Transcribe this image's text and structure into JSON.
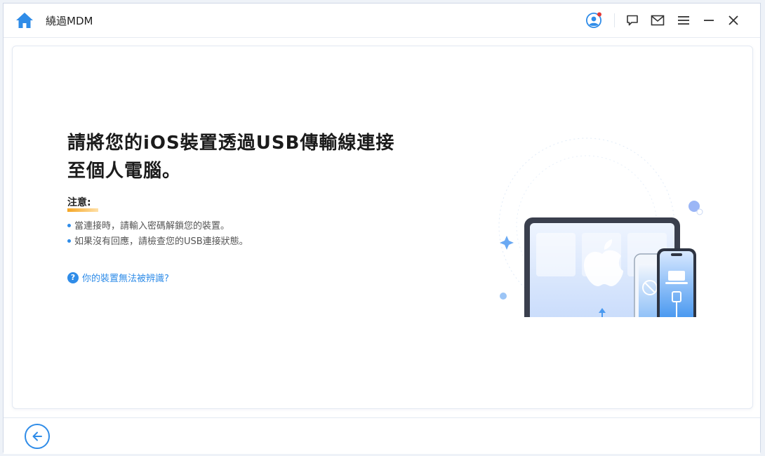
{
  "titlebar": {
    "app_title": "繞過MDM",
    "icons": [
      "home-icon",
      "user-avatar-icon",
      "feedback-icon",
      "mail-icon",
      "menu-icon",
      "minimize-icon",
      "close-icon"
    ]
  },
  "main": {
    "heading": "請將您的iOS裝置透過USB傳輸線連接至個人電腦。",
    "note_title": "注意:",
    "notes": [
      "當連接時，請輸入密碼解鎖您的裝置。",
      "如果沒有回應，請檢查您的USB連接狀態。"
    ],
    "help_link": "你的裝置無法被辨識?"
  },
  "footer": {
    "icons": [
      "back-arrow-icon"
    ]
  },
  "colors": {
    "accent": "#2f8ce8",
    "note_underline": "#f5a623",
    "notification_dot": "#e53935"
  }
}
